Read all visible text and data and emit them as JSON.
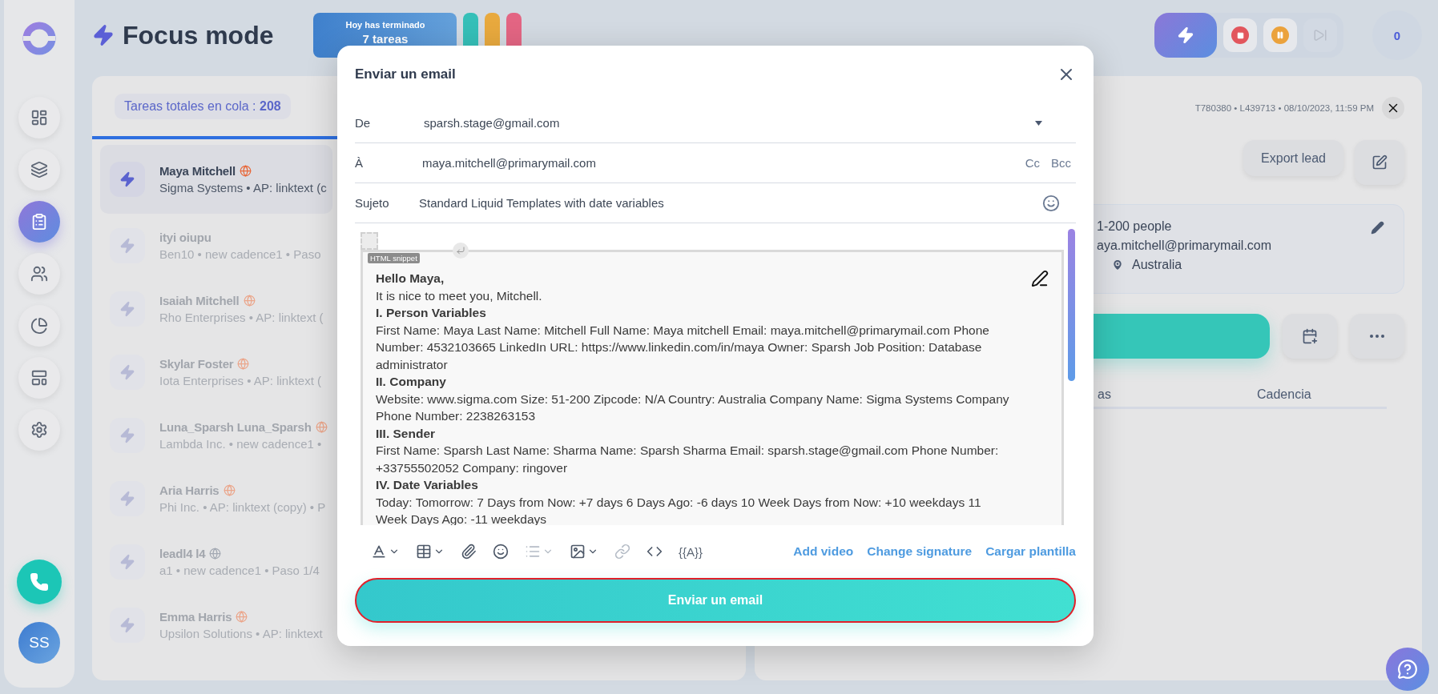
{
  "sidebar": {
    "items": [
      {
        "selected": false
      },
      {
        "selected": false
      },
      {
        "selected": true
      },
      {
        "selected": false
      },
      {
        "selected": false
      },
      {
        "selected": false
      },
      {
        "selected": false
      }
    ],
    "avatar": "SS"
  },
  "header": {
    "title": "Focus mode",
    "banner": {
      "line_1": "Hoy has terminado",
      "line_2": "7 tareas"
    },
    "color_tabs": [
      {
        "color": "#35bfb8"
      },
      {
        "color": "#e8a93e"
      },
      {
        "color": "#e36583"
      }
    ],
    "controls": [
      {
        "kind": "focus",
        "disabled": false
      },
      {
        "kind": "stop",
        "disabled": false
      },
      {
        "kind": "pause",
        "disabled": false
      },
      {
        "kind": "next",
        "disabled": true
      }
    ],
    "counter": "0"
  },
  "queue": {
    "label": "Tareas totales en cola : ",
    "count": "208",
    "tasks": [
      {
        "name": "Maya Mitchell",
        "detail": "Sigma Systems • AP: linktext (c",
        "selected": true,
        "color": "#e8683a"
      },
      {
        "name": "ityi oiupu",
        "detail": "Ben10 • new cadence1 • Paso",
        "selected": false
      },
      {
        "name": "Isaiah Mitchell",
        "detail": "Rho Enterprises • AP: linktext (",
        "selected": false,
        "color": "#eba68b"
      },
      {
        "name": "Skylar Foster",
        "detail": "Iota Enterprises • AP: linktext (",
        "selected": false,
        "color": "#eba68b"
      },
      {
        "name": "Luna_Sparsh Luna_Sparsh",
        "detail": "Lambda Inc. • new cadence1 •",
        "selected": false,
        "color": "#eba68b"
      },
      {
        "name": "Aria Harris",
        "detail": "Phi Inc. • AP: linktext (copy) • P",
        "selected": false,
        "color": "#eba68b"
      },
      {
        "name": "leadl4 l4",
        "detail": "a1 • new cadence1 • Paso 1/4",
        "selected": false,
        "color": "#a3a9b3"
      },
      {
        "name": "Emma Harris",
        "detail": "Upsilon Solutions • AP: linktext",
        "selected": false,
        "color": "#eba68b"
      }
    ]
  },
  "lead": {
    "meta": "T780380 • L439713 • 08/10/2023, 11:59 PM",
    "export_button": "Export lead",
    "size": "1-200 people",
    "email": "aya.mitchell@primarymail.com",
    "country": "Australia",
    "columns": [
      "as",
      "Cadencia"
    ]
  },
  "modal": {
    "title": "Enviar un email",
    "fields": [
      {
        "kind": "select",
        "label": "De",
        "value": "sparsh.stage@gmail.com"
      },
      {
        "kind": "recipients",
        "label": "À",
        "value": "maya.mitchell@primarymail.com",
        "extras": [
          "Cc",
          "Bcc"
        ]
      },
      {
        "kind": "subject",
        "label": "Sujeto",
        "value": "Standard Liquid Templates with date variables"
      }
    ],
    "snippet_tag": "HTML snippet",
    "body": [
      {
        "kind": "heading",
        "text": "Hello Maya,"
      },
      {
        "kind": "text",
        "text": "It is nice to meet you, Mitchell."
      },
      {
        "kind": "heading",
        "text": "I. Person Variables"
      },
      {
        "kind": "text",
        "text": "First Name: Maya Last Name: Mitchell Full Name: Maya mitchell Email: maya.mitchell@primarymail.com Phone Number: 4532103665 LinkedIn URL: https://www.linkedin.com/in/maya Owner: Sparsh Job Position: Database administrator"
      },
      {
        "kind": "heading",
        "text": "II. Company"
      },
      {
        "kind": "text",
        "text": "Website: www.sigma.com Size: 51-200 Zipcode: N/A Country: Australia Company Name: Sigma Systems Company Phone Number: 2238263153"
      },
      {
        "kind": "heading",
        "text": "III. Sender"
      },
      {
        "kind": "text",
        "text": "First Name: Sparsh Last Name: Sharma Name: Sparsh Sharma Email: sparsh.stage@gmail.com Phone Number: +33755502052 Company: ringover"
      },
      {
        "kind": "heading",
        "text": "IV. Date Variables"
      },
      {
        "kind": "text",
        "text": "Today: Tomorrow: 7 Days from Now: +7 days 6 Days Ago: -6 days 10 Week Days from Now: +10 weekdays 11 Week Days Ago: -11 weekdays"
      }
    ],
    "tools": [
      {
        "dropdown": true,
        "disabled": false
      },
      {
        "dropdown": true,
        "disabled": false
      },
      {
        "dropdown": false,
        "disabled": false
      },
      {
        "dropdown": false,
        "disabled": false
      },
      {
        "dropdown": true,
        "disabled": true
      },
      {
        "dropdown": true,
        "disabled": false
      },
      {
        "dropdown": false,
        "disabled": true
      },
      {
        "dropdown": false,
        "disabled": false
      }
    ],
    "variable_tool": "{{A}}",
    "links": [
      "Add video",
      "Change signature",
      "Cargar plantilla"
    ],
    "send_button": "Enviar un email"
  }
}
